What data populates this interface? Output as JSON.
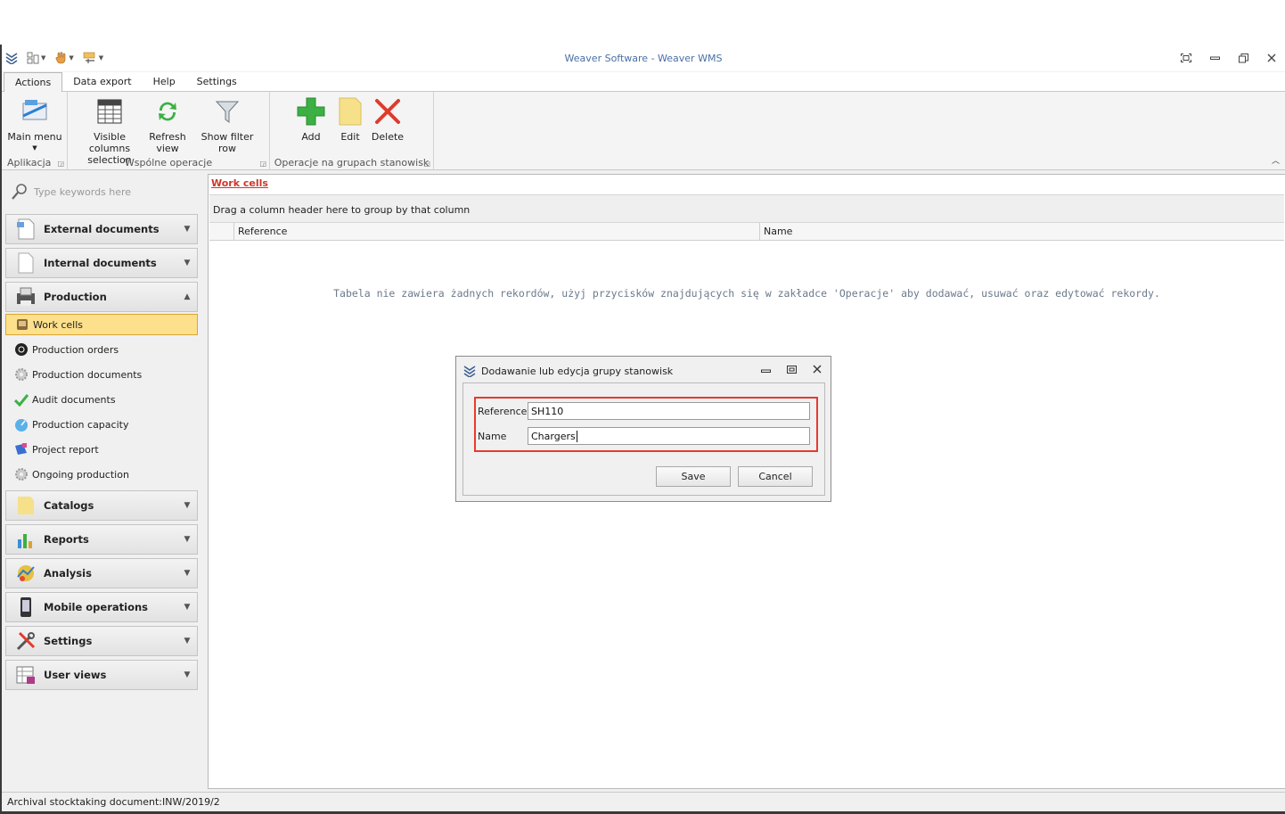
{
  "window": {
    "title": "Weaver Software - Weaver WMS"
  },
  "menu_tabs": [
    "Actions",
    "Data export",
    "Help",
    "Settings"
  ],
  "ribbon": {
    "groups": [
      {
        "name": "Aplikacja",
        "buttons": [
          {
            "label": "Main menu",
            "icon": "main-menu-icon"
          }
        ]
      },
      {
        "name": "Wspólne operacje",
        "buttons": [
          {
            "label": "Visible columns selection",
            "icon": "columns-icon"
          },
          {
            "label": "Refresh view",
            "icon": "refresh-icon"
          },
          {
            "label": "Show filter row",
            "icon": "filter-icon"
          }
        ]
      },
      {
        "name": "Operacje na grupach stanowisk",
        "buttons": [
          {
            "label": "Add",
            "icon": "add-icon"
          },
          {
            "label": "Edit",
            "icon": "edit-icon"
          },
          {
            "label": "Delete",
            "icon": "delete-icon"
          }
        ]
      }
    ]
  },
  "sidebar": {
    "search_placeholder": "Type keywords here",
    "sections": [
      {
        "label": "External documents",
        "icon": "document-icon",
        "expanded": false
      },
      {
        "label": "Internal documents",
        "icon": "page-icon",
        "expanded": false
      },
      {
        "label": "Production",
        "icon": "printer-icon",
        "expanded": true
      },
      {
        "label": "Catalogs",
        "icon": "folder-icon",
        "expanded": false
      },
      {
        "label": "Reports",
        "icon": "bar-chart-icon",
        "expanded": false
      },
      {
        "label": "Analysis",
        "icon": "analysis-icon",
        "expanded": false
      },
      {
        "label": "Mobile operations",
        "icon": "mobile-icon",
        "expanded": false
      },
      {
        "label": "Settings",
        "icon": "tools-icon",
        "expanded": false
      },
      {
        "label": "User views",
        "icon": "user-views-icon",
        "expanded": false
      }
    ],
    "production_items": [
      {
        "label": "Work cells",
        "icon": "work-cells-icon",
        "selected": true
      },
      {
        "label": "Production orders",
        "icon": "orders-icon"
      },
      {
        "label": "Production documents",
        "icon": "gear-icon"
      },
      {
        "label": "Audit documents",
        "icon": "checkmark-icon"
      },
      {
        "label": "Production capacity",
        "icon": "gauge-icon"
      },
      {
        "label": "Project report",
        "icon": "report-icon"
      },
      {
        "label": "Ongoing production",
        "icon": "gear-icon"
      }
    ]
  },
  "main": {
    "breadcrumb": "Work cells",
    "group_hint": "Drag a column header here to group by that column",
    "columns": [
      "Reference",
      "Name"
    ],
    "empty_message": "Tabela nie zawiera żadnych rekordów, użyj przycisków znajdujących się w zakładce 'Operacje' aby dodawać, usuwać oraz edytować rekordy."
  },
  "dialog": {
    "title": "Dodawanie lub edycja grupy stanowisk",
    "fields": [
      {
        "label": "Reference",
        "value": "SH110"
      },
      {
        "label": "Name",
        "value": "Chargers"
      }
    ],
    "save_label": "Save",
    "cancel_label": "Cancel"
  },
  "status_bar": {
    "text": "Archival stocktaking document:INW/2019/2"
  },
  "colors": {
    "accent": "#4a6fa5",
    "breadcrumb": "#d0362a",
    "highlight": "#e53b2c",
    "selected": "#fde08c"
  }
}
